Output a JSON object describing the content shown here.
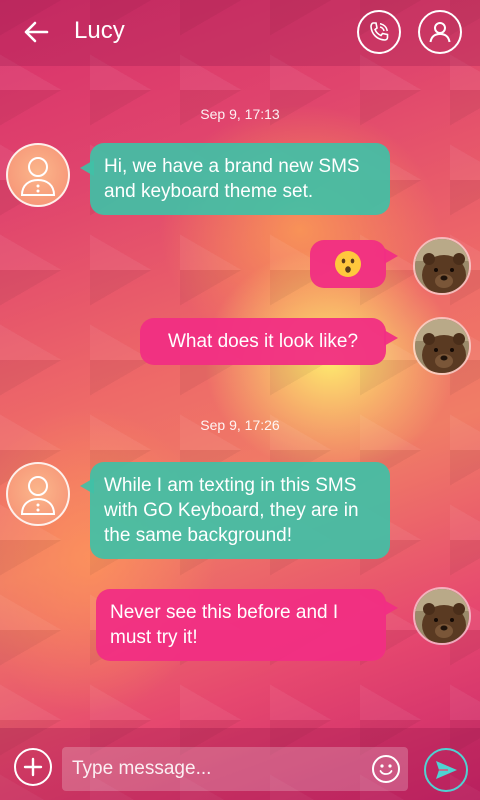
{
  "header": {
    "title": "Lucy",
    "back_icon": "back-arrow-icon",
    "call_icon": "phone-icon",
    "contact_icon": "contact-icon"
  },
  "conversation": {
    "stamps": [
      "Sep 9, 17:13",
      "Sep 9, 17:26"
    ],
    "messages": [
      {
        "direction": "incoming",
        "text": "Hi, we have a brand new SMS and keyboard theme set."
      },
      {
        "direction": "outgoing",
        "emoji": "surprised-face-emoji"
      },
      {
        "direction": "outgoing",
        "text": "What does it look like?"
      },
      {
        "direction": "incoming",
        "text": "While I am texting in this SMS with GO Keyboard, they are in the same background!"
      },
      {
        "direction": "outgoing",
        "text": "Never see this before and I must try it!"
      }
    ]
  },
  "composer": {
    "placeholder": "Type message...",
    "add_icon": "plus-icon",
    "emoji_icon": "smiley-icon",
    "send_icon": "send-icon"
  },
  "colors": {
    "incoming_bubble": "#40c0a6",
    "outgoing_bubble": "#f12e83",
    "send_accent": "#4fd2d2"
  }
}
